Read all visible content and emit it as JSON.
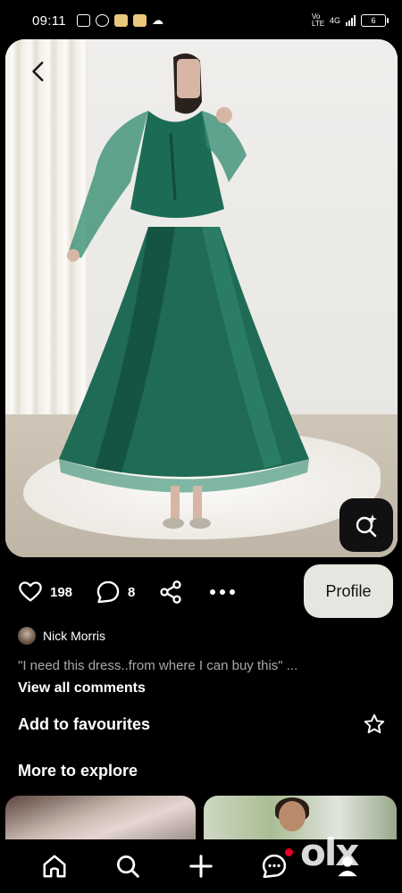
{
  "status_bar": {
    "time": "09:11",
    "network": "4G",
    "volte": "Vo LTE",
    "battery": "6"
  },
  "pin": {
    "like_count": "198",
    "comment_count": "8",
    "profile_label": "Profile"
  },
  "comments": {
    "author": "Nick Morris",
    "text": "\"I need this dress..from where I can buy this\" ...",
    "view_all": "View all comments"
  },
  "favourites": {
    "label": "Add to favourites"
  },
  "explore": {
    "heading": "More to explore"
  },
  "watermark": {
    "text": "olx"
  },
  "icons": {
    "back": "chevron-left-icon",
    "visual_search": "visual-search-icon",
    "like": "heart-icon",
    "comment": "comment-bubble-icon",
    "share": "share-icon",
    "more": "more-dots-icon",
    "star": "star-icon",
    "home": "home-icon",
    "search": "search-icon",
    "create": "plus-icon",
    "messages": "messages-icon",
    "profile": "user-icon"
  },
  "colors": {
    "background": "#000000",
    "profile_button": "#e6e6e1",
    "comment_grey": "#a9a9a9",
    "notification": "#e60023",
    "dress_green": "#1f6b55"
  }
}
